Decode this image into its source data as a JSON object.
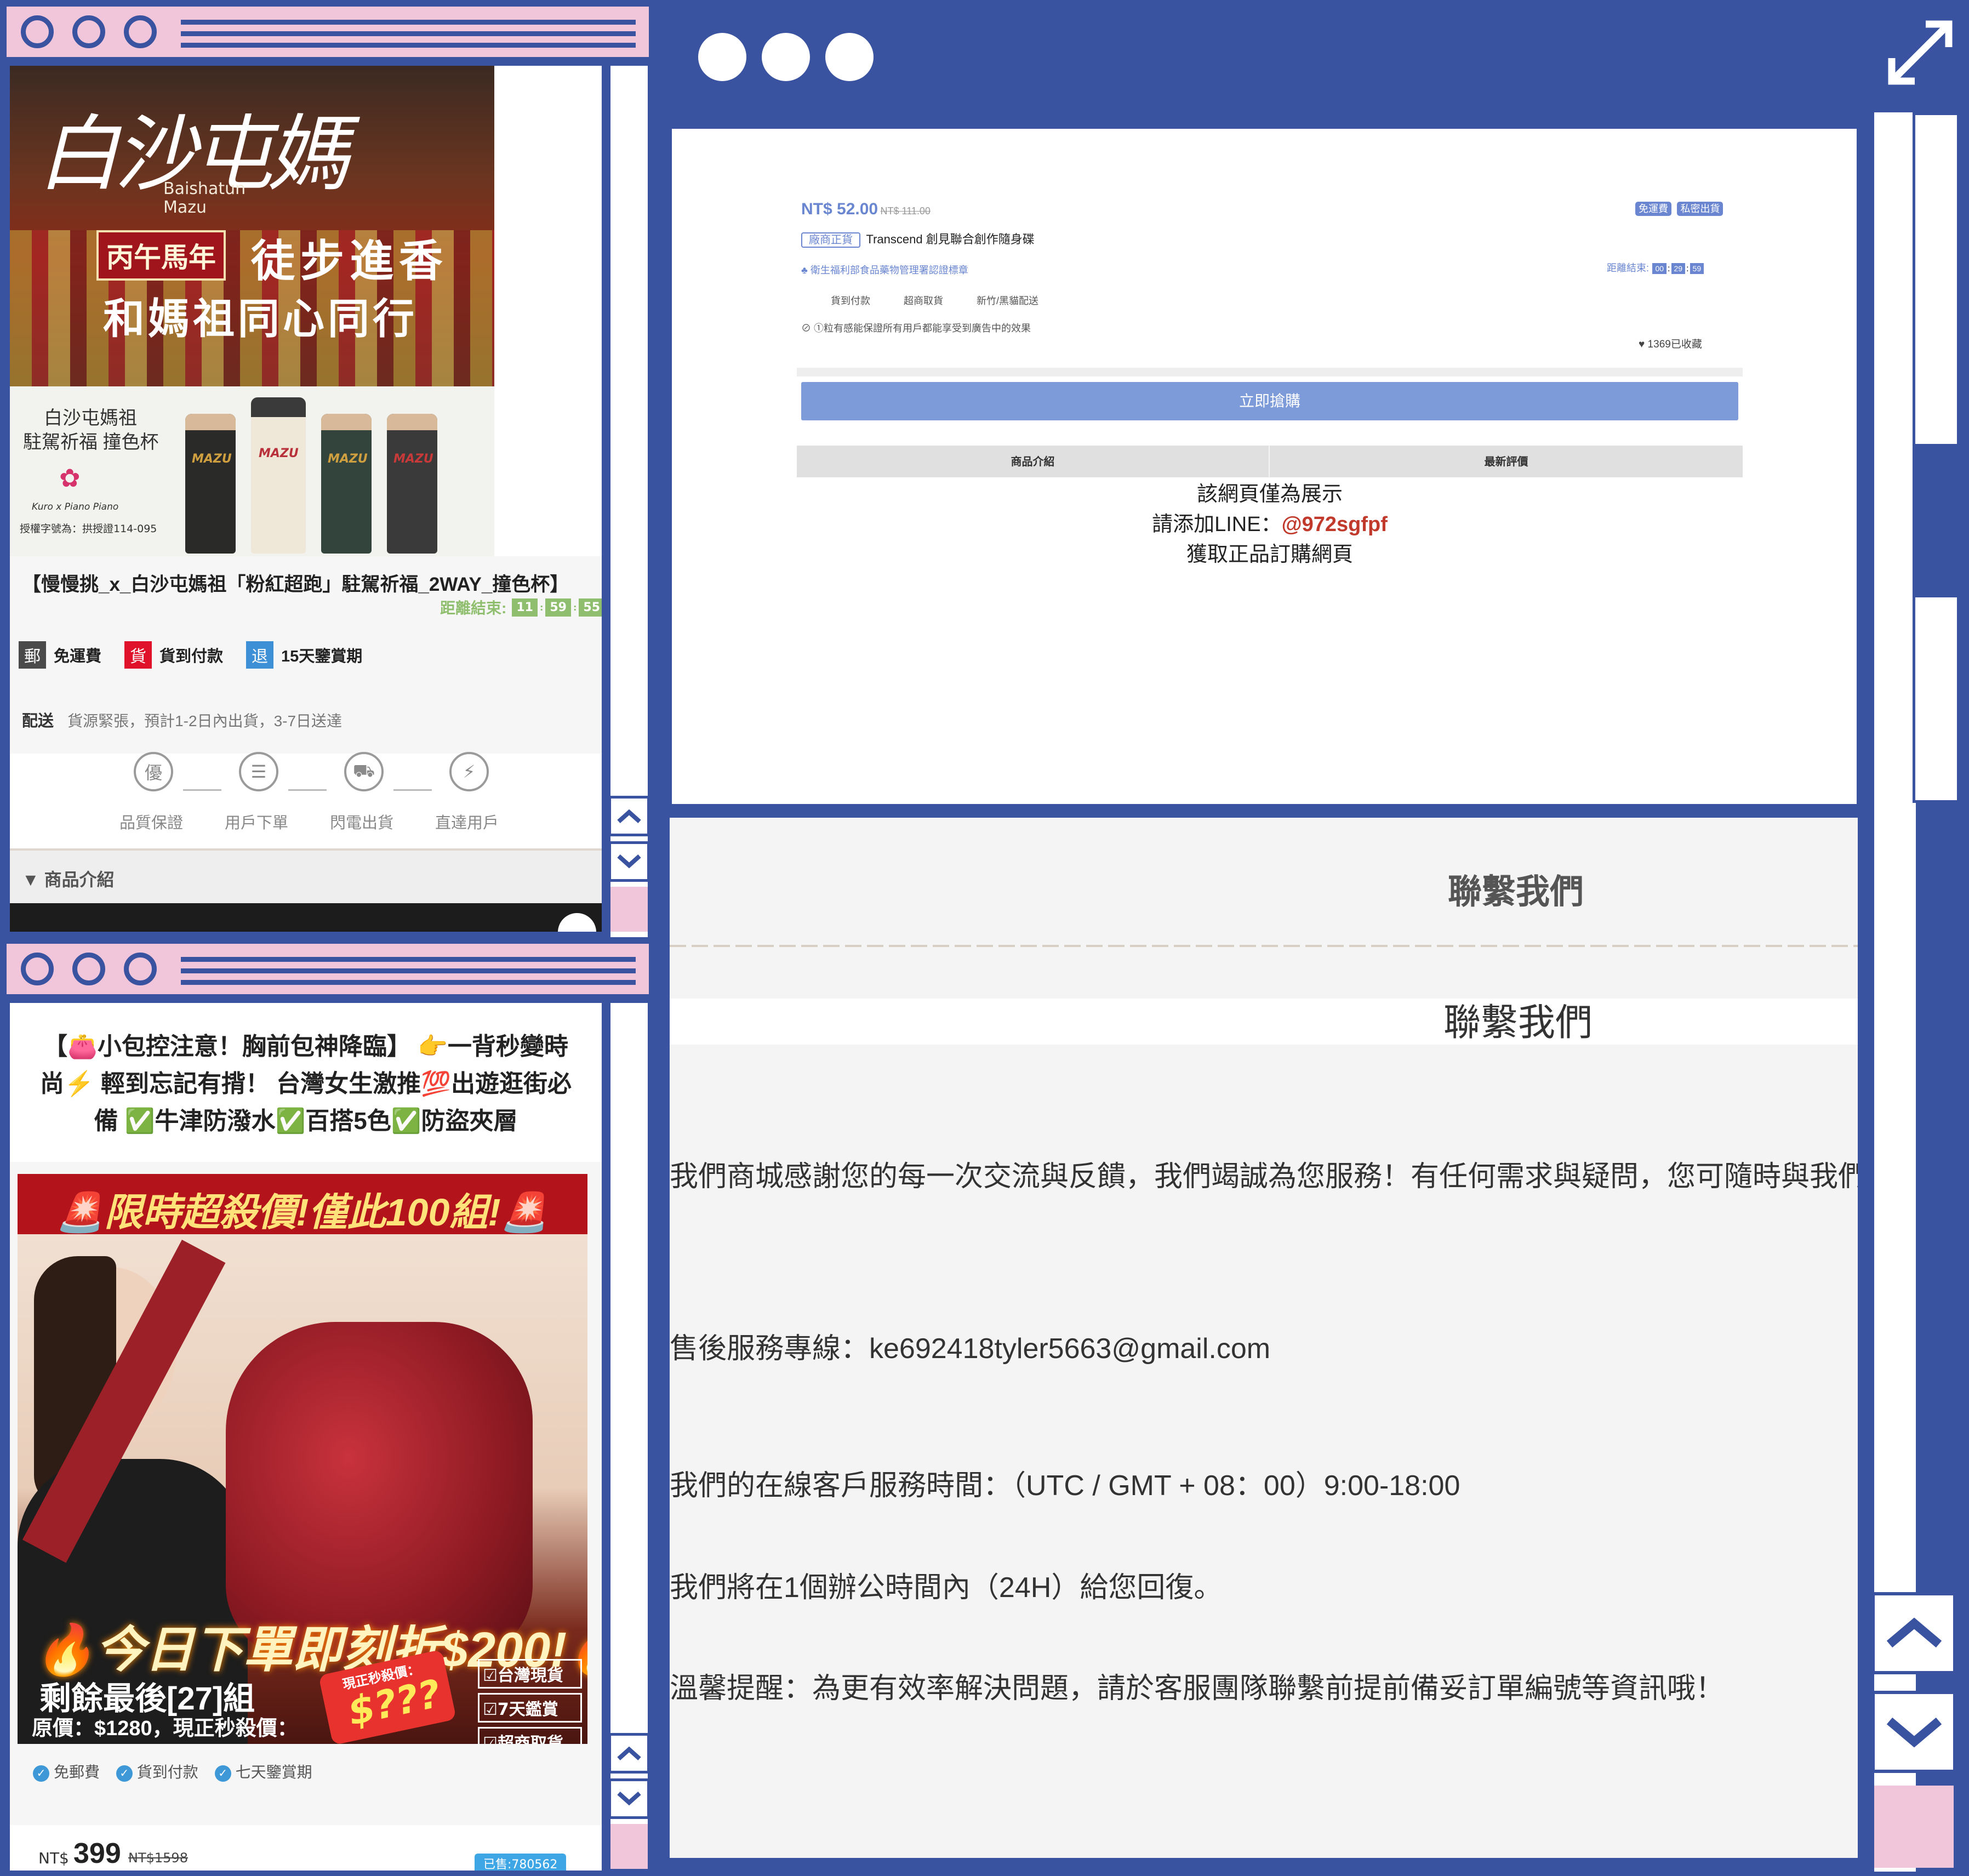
{
  "colors": {
    "frame": "#3a53a0",
    "accent_pink": "#f2c6da",
    "price_blue": "#6a86d1",
    "line_red": "#c0392b"
  },
  "window_a": {
    "banner": {
      "calligraphy": "白沙屯媽",
      "roman": "Baishatun Mazu",
      "year_tag": "丙午馬年",
      "slogan_1": "徒步進香",
      "slogan_2": "和媽祖同心同行",
      "product_heading_1": "白沙屯媽祖",
      "product_heading_2": "駐駕祈福 撞色杯",
      "brand": "Kuro x Piano Piano",
      "license": "授權字號為：拱授證114-095",
      "cup_mark": "MAZU"
    },
    "title": "【慢慢挑_x_白沙屯媽祖「粉紅超跑」駐駕祈福_2WAY_撞色杯】",
    "countdown_label": "距離結束:",
    "countdown": [
      "11",
      "59",
      "55"
    ],
    "badges": [
      {
        "icon_char": "郵",
        "label": "免運費",
        "color": "#4a4a4a"
      },
      {
        "icon_char": "貨",
        "label": "貨到付款",
        "color": "#e0112b"
      },
      {
        "icon_char": "退",
        "label": "15天鑒賞期",
        "color": "#3d8fd6"
      }
    ],
    "shipping_label": "配送",
    "shipping_text": "貨源緊張，預計1-2日內出貨，3-7日送達",
    "steps": [
      {
        "icon": "quality-icon",
        "glyph": "優",
        "label": "品質保證"
      },
      {
        "icon": "order-icon",
        "glyph": "☰",
        "label": "用戶下單"
      },
      {
        "icon": "delivery-truck-icon",
        "glyph": "⛟",
        "label": "閃電出貨"
      },
      {
        "icon": "lightning-icon",
        "glyph": "⚡",
        "label": "直達用戶"
      }
    ],
    "section_label": "▼ 商品介紹"
  },
  "window_b": {
    "headline": "【👛小包控注意！胸前包神降臨】 👉一背秒變時尚⚡ 輕到忘記有揹！ 台灣女生激推💯出遊逛街必備 ✅牛津防潑水✅百搭5色✅防盜夾層",
    "promo_top": "🚨限時超殺價!僅此100組!🚨",
    "promo_discount": "🔥今日下單即刻折$200!🔥",
    "promo_remaining": "剩餘最後[27]組",
    "promo_price_line": "原價：$1280，現正秒殺價：",
    "promo_tag_label": "現正秒殺價：",
    "promo_tag_price": "$???",
    "promo_checks": [
      "☑台灣現貨",
      "☑7天鑑賞",
      "☑超商取貨"
    ],
    "services": [
      "免郵費",
      "貨到付款",
      "七天鑒賞期"
    ],
    "price_prefix": "NT$",
    "price": "399",
    "price_original": "NT$1598",
    "sold_tag": "已售:780562"
  },
  "window_c": {
    "preview": {
      "price": "NT$ 52.00",
      "price_original": "NT$ 111.00",
      "tags": [
        "免運費",
        "私密出貨"
      ],
      "brand_tag": "廠商正貨",
      "product_name": "Transcend 創見聯合創作隨身碟",
      "cert": "♣ 衛生福利部食品藥物管理署認證標章",
      "countdown_label": "距離結束:",
      "countdown": [
        "00",
        "29",
        "59"
      ],
      "services": [
        "貨到付款",
        "超商取貨",
        "新竹/黑貓配送"
      ],
      "notice": "⊘ ①粒有感能保證所有用戶都能享受到廣告中的效果",
      "favorites": "♥ 1369已收藏",
      "buy_button": "立即搶購",
      "tab_intro": "商品介紹",
      "tab_reviews": "最新評價",
      "demo_line_1": "該網頁僅為展示",
      "demo_line_2_prefix": "請添加LINE：",
      "demo_line_2_id": "@972sgfpf",
      "demo_line_3": "獲取正品訂購網頁"
    },
    "contact": {
      "heading_1": "聯繫我們",
      "heading_2": "聯繫我們",
      "paragraph_1": "我們商城感謝您的每一次交流與反饋，我們竭誠為您服務！有任何需求與疑問，您可隨時與我們聯絡。",
      "paragraph_2": "售後服務專線：ke692418tyler5663@gmail.com",
      "paragraph_3": "我們的在線客戶服務時間：（UTC / GMT + 08：00）9:00-18:00",
      "paragraph_4": "我們將在1個辦公時間內（24H）給您回復。",
      "paragraph_5": "溫馨提醒：為更有效率解決問題，請於客服團隊聯繫前提前備妥訂單編號等資訊哦！"
    }
  }
}
